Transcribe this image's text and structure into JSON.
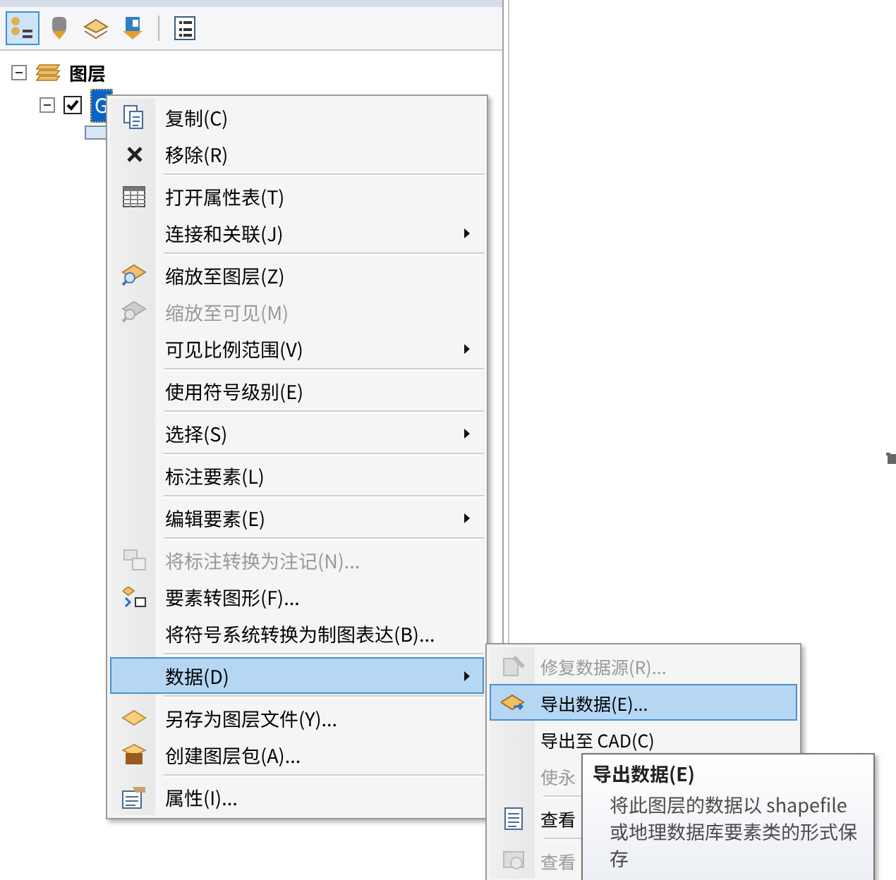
{
  "toolbar": [
    {
      "selected": true
    },
    {
      "selected": false
    },
    {
      "selected": false
    },
    {
      "selected": false
    },
    {
      "selected": false
    }
  ],
  "tree": {
    "label": "图层",
    "expanded": true,
    "children": [
      {
        "label": "G",
        "checked": true,
        "selected": true,
        "expanded": true
      }
    ]
  },
  "context_menu": [
    {
      "kind": "item",
      "label": "复制(C)",
      "disabled": false,
      "submenu": false,
      "selected": false
    },
    {
      "kind": "item",
      "label": "移除(R)",
      "disabled": false,
      "submenu": false,
      "selected": false
    },
    {
      "kind": "separator"
    },
    {
      "kind": "item",
      "label": "打开属性表(T)",
      "disabled": false,
      "submenu": false,
      "selected": false
    },
    {
      "kind": "item",
      "label": "连接和关联(J)",
      "disabled": false,
      "submenu": true,
      "selected": false
    },
    {
      "kind": "separator"
    },
    {
      "kind": "item",
      "label": "缩放至图层(Z)",
      "disabled": false,
      "submenu": false,
      "selected": false
    },
    {
      "kind": "item",
      "label": "缩放至可见(M)",
      "disabled": true,
      "submenu": false,
      "selected": false
    },
    {
      "kind": "item",
      "label": "可见比例范围(V)",
      "disabled": false,
      "submenu": true,
      "selected": false
    },
    {
      "kind": "separator"
    },
    {
      "kind": "item",
      "label": "使用符号级别(E)",
      "disabled": false,
      "submenu": false,
      "selected": false
    },
    {
      "kind": "separator"
    },
    {
      "kind": "item",
      "label": "选择(S)",
      "disabled": false,
      "submenu": true,
      "selected": false
    },
    {
      "kind": "separator"
    },
    {
      "kind": "item",
      "label": "标注要素(L)",
      "disabled": false,
      "submenu": false,
      "selected": false
    },
    {
      "kind": "separator"
    },
    {
      "kind": "item",
      "label": "编辑要素(E)",
      "disabled": false,
      "submenu": true,
      "selected": false
    },
    {
      "kind": "separator"
    },
    {
      "kind": "item",
      "label": "将标注转换为注记(N)...",
      "disabled": true,
      "submenu": false,
      "selected": false
    },
    {
      "kind": "item",
      "label": "要素转图形(F)...",
      "disabled": false,
      "submenu": false,
      "selected": false
    },
    {
      "kind": "item",
      "label": "将符号系统转换为制图表达(B)...",
      "disabled": false,
      "submenu": false,
      "selected": false
    },
    {
      "kind": "separator"
    },
    {
      "kind": "item",
      "label": "数据(D)",
      "disabled": false,
      "submenu": true,
      "selected": true
    },
    {
      "kind": "separator"
    },
    {
      "kind": "item",
      "label": "另存为图层文件(Y)...",
      "disabled": false,
      "submenu": false,
      "selected": false
    },
    {
      "kind": "item",
      "label": "创建图层包(A)...",
      "disabled": false,
      "submenu": false,
      "selected": false
    },
    {
      "kind": "separator"
    },
    {
      "kind": "item",
      "label": "属性(I)...",
      "disabled": false,
      "submenu": false,
      "selected": false
    }
  ],
  "submenu": [
    {
      "kind": "item",
      "label": "修复数据源(R)...",
      "disabled": true,
      "selected": false
    },
    {
      "kind": "item",
      "label": "导出数据(E)...",
      "disabled": false,
      "selected": true
    },
    {
      "kind": "item",
      "label": "导出至 CAD(C)",
      "disabled": false,
      "selected": false
    },
    {
      "kind": "item",
      "label": "使永",
      "disabled": true,
      "selected": false
    },
    {
      "kind": "separator"
    },
    {
      "kind": "item",
      "label": "查看",
      "disabled": false,
      "selected": false
    },
    {
      "kind": "separator"
    },
    {
      "kind": "item",
      "label": "查看",
      "disabled": true,
      "selected": false
    }
  ],
  "tooltip": {
    "title": "导出数据(E)",
    "text": "将此图层的数据以 shapefile 或地理数据库要素类的形式保存"
  }
}
